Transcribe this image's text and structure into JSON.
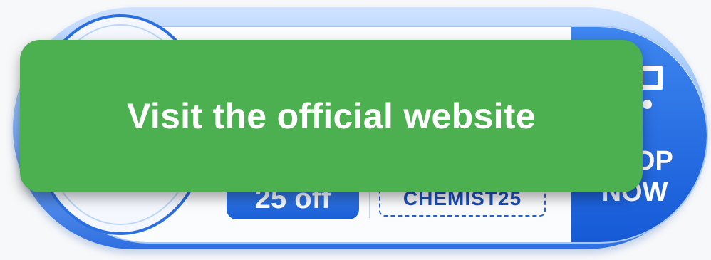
{
  "promo": {
    "discount_text": "25 off",
    "coupon_code": "CHEMIST25",
    "shop_label": "SHOP NOW",
    "cart_icon": "shopping-cart-icon"
  },
  "cta": {
    "label": "Visit the official website"
  },
  "colors": {
    "cta_green": "#4caf50",
    "accent_blue": "#1f63db",
    "text_white": "#ffffff"
  }
}
